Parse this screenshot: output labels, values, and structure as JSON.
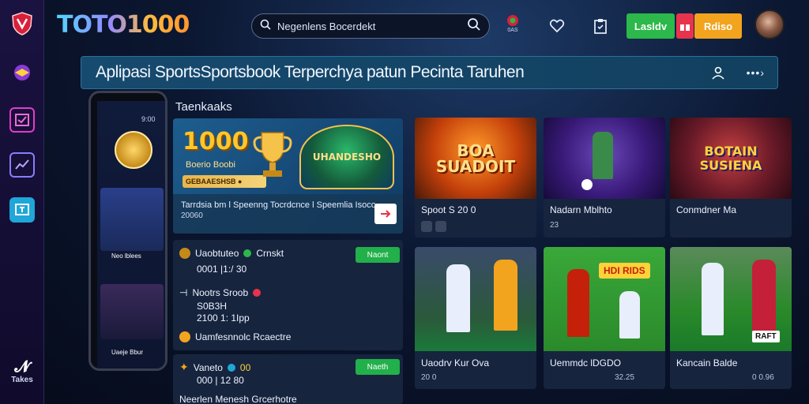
{
  "app": {
    "logo": "TOTO1000"
  },
  "search": {
    "placeholder": "Negenlens Bocerdekt"
  },
  "header": {
    "notif_label": "0AS",
    "login_label": "Lasldv",
    "register_label": "Rdiso"
  },
  "banner": {
    "title": "Aplipasi SportsSportsbook Terperchya patun Pecinta Taruhen",
    "more": "•••›"
  },
  "sidebar": {
    "bottom_label": "Takes"
  },
  "phone": {
    "time": "9:00",
    "player1": "Neo lblees",
    "player2": "Uaeje Bbur"
  },
  "section": {
    "title": "Taenkaaks"
  },
  "featured": {
    "headline": "1000",
    "subtitle": "Boerio Boobi",
    "pill": "GEBAAESHSB ●",
    "art_text": "UHANDESHO",
    "text": "Tarrdsia bm l Speenng Tocrdcnce l Speemlia Isoco",
    "number": "20060"
  },
  "cards": [
    {
      "name": "Spoot S 20 0",
      "meta": "",
      "art": "BOA SUADOIT"
    },
    {
      "name": "Nadarn Mblhto",
      "meta": "23"
    },
    {
      "name": "Conmdner Ma",
      "meta": "",
      "art": "BOTAIN SUSIENA"
    },
    {
      "name": "Uaodrv Kur Ova",
      "meta": "20 0",
      "art": ""
    },
    {
      "name": "Uemmdc lDGDO",
      "meta": "32.25",
      "art": "HDI RIDS"
    },
    {
      "name": "Kancain Balde",
      "meta": "0 0.96",
      "art": "RAFT"
    }
  ],
  "matches": [
    {
      "title": "Uaobtuteo",
      "extra": "Crnskt",
      "sub": "0001 |1:/ 30",
      "button": "Naont"
    },
    {
      "title": "Nootrs Sroob",
      "extra": "",
      "sub": "S0B3H",
      "sub2": "2100 1: 1Ipp"
    },
    {
      "title": "Uamfesnnolc Rcaectre",
      "extra": "",
      "sub": ""
    },
    {
      "title": "Vaneto",
      "extra": "00",
      "sub": "000 | 12 80",
      "button": "Naeth"
    },
    {
      "title": "Neerlen Menesh Grcerhotre",
      "extra": "",
      "sub": ""
    }
  ],
  "colors": {
    "accent_green": "#22b04a",
    "accent_orange": "#f2a41f",
    "accent_red": "#e8334d",
    "banner": "#164a6e"
  }
}
